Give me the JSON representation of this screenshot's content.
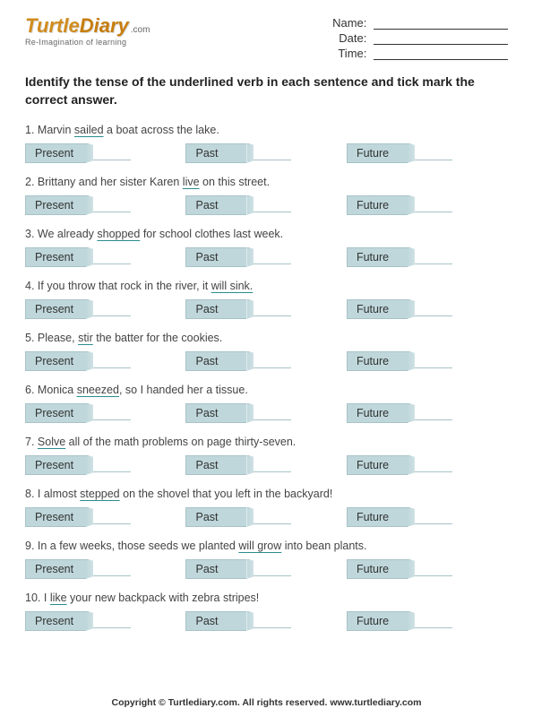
{
  "logo": {
    "turtle": "Turtle",
    "diary": "Diary",
    "dotcom": ".com",
    "tagline": "Re-Imagination of learning"
  },
  "meta": {
    "name_label": "Name:",
    "date_label": "Date:",
    "time_label": "Time:"
  },
  "instructions": "Identify the tense of the underlined verb in each sentence and tick mark the correct answer.",
  "options": {
    "present": "Present",
    "past": "Past",
    "future": "Future"
  },
  "questions": [
    {
      "num": "1.",
      "pre": "Marvin ",
      "u": "sailed",
      "post": " a boat across the lake."
    },
    {
      "num": "2.",
      "pre": "Brittany and her sister Karen ",
      "u": "live",
      "post": " on this street."
    },
    {
      "num": "3.",
      "pre": "We already ",
      "u": "shopped",
      "post": " for school clothes last week."
    },
    {
      "num": "4.",
      "pre": "If you throw that rock in the river, it ",
      "u": "will sink.",
      "post": ""
    },
    {
      "num": "5.",
      "pre": "Please, ",
      "u": "stir",
      "post": " the batter for the cookies."
    },
    {
      "num": "6.",
      "pre": "Monica ",
      "u": "sneezed",
      "post": ", so I handed her a tissue."
    },
    {
      "num": "7.",
      "pre": "",
      "u": "Solve",
      "post": " all of the math problems on page thirty-seven."
    },
    {
      "num": "8.",
      "pre": "I almost ",
      "u": "stepped",
      "post": " on the shovel that you left in the backyard!"
    },
    {
      "num": "9.",
      "pre": "In a few weeks, those seeds we planted ",
      "u": "will grow",
      "post": " into bean plants."
    },
    {
      "num": "10.",
      "pre": "I ",
      "u": "like",
      "post": " your new backpack with zebra stripes!"
    }
  ],
  "footer": "Copyright © Turtlediary.com. All rights reserved. www.turtlediary.com"
}
